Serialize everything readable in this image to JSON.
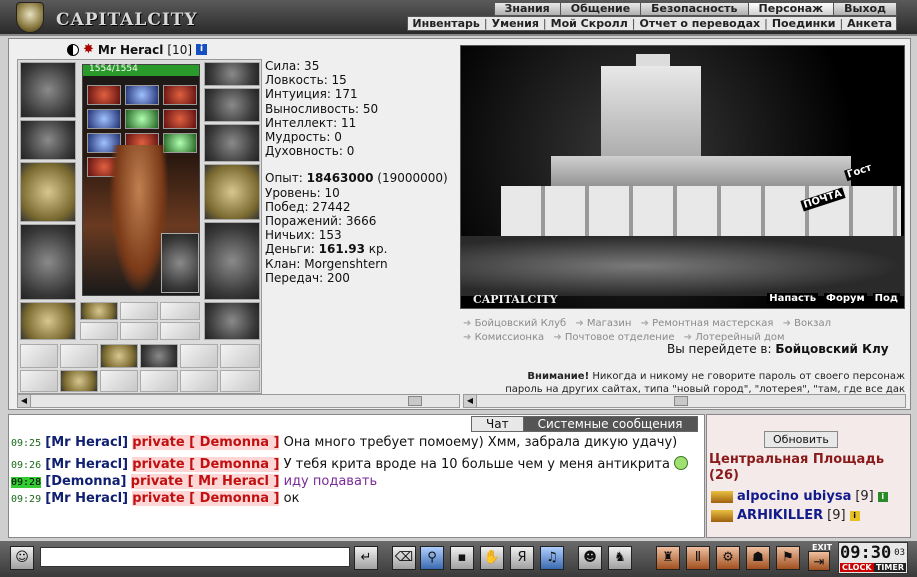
{
  "brand": "CAPITALCITY",
  "nav_top": [
    "Знания",
    "Общение",
    "Безопасность",
    "Персонаж",
    "Выход"
  ],
  "nav_sub": [
    "Инвентарь",
    "Умения",
    "Мой Скролл",
    "Отчет о переводах",
    "Поединки",
    "Анкета"
  ],
  "character": {
    "name": "Mr Heracl",
    "level": "[10]",
    "hp": "1554/1554"
  },
  "stats": {
    "strength": "Сила: 35",
    "agility": "Ловкость: 15",
    "intuition": "Интуиция: 171",
    "endurance": "Выносливость: 50",
    "intellect": "Интеллект: 11",
    "wisdom": "Мудрость: 0",
    "spirit": "Духовность: 0",
    "exp_label": "Опыт:",
    "exp_value": "18463000",
    "exp_next": "(19000000)",
    "level": "Уровень: 10",
    "wins": "Побед: 27442",
    "losses": "Поражений: 3666",
    "draws": "Ничьих: 153",
    "money_label": "Деньги:",
    "money_value": "161.93",
    "money_unit": "кр.",
    "clan": "Клан: Morgenshtern",
    "transfers": "Передач: 200"
  },
  "city": {
    "label": "CAPITALCITY",
    "links": [
      "Напасть",
      "Форум",
      "Под"
    ],
    "signs": [
      "ПОЧТА",
      "Гост"
    ]
  },
  "places": [
    "Бойцовский Клуб",
    "Магазин",
    "Ремонтная мастерская",
    "Вокзал",
    "Комиссионка",
    "Почтовое отделение",
    "Лотерейный дом"
  ],
  "goto": {
    "prefix": "Вы перейдете в:",
    "target": "Бойцовский Клу"
  },
  "warning": {
    "title": "Внимание!",
    "line1": "Никогда и никому не говорите пароль от своего персонаж",
    "line2": "пароль на других сайтах, типа \"новый город\", \"лотерея\", \"там, где все дак"
  },
  "chat_tabs": [
    "Чат",
    "Системные сообщения"
  ],
  "chat": [
    {
      "time": "09:25",
      "nick": "[Mr Heracl]",
      "priv": "private [ Demonna ]",
      "text": "Она много требует помоему) Хмм, забрала дикую удачу)"
    },
    {
      "time": "09:26",
      "nick": "[Mr Heracl]",
      "priv": "private [ Demonna ]",
      "text": "У тебя крита вроде на 10 больше чем у меня антикрита"
    },
    {
      "time": "09:28",
      "nick": "[Demonna]",
      "priv": "private [ Mr Heracl ]",
      "text": "иду подавать"
    },
    {
      "time": "09:29",
      "nick": "[Mr Heracl]",
      "priv": "private [ Demonna ]",
      "text": "ок"
    }
  ],
  "online": {
    "refresh": "Обновить",
    "room": "Центральная Площадь",
    "count": "(26)",
    "users": [
      {
        "name": "alpocino ubiysa",
        "level": "[9]"
      },
      {
        "name": "ARHIKILLER",
        "level": "[9]"
      }
    ]
  },
  "clock": {
    "time": "09:30",
    "seconds": "03",
    "clock_label": "CLOCK",
    "timer_label": "TIMER",
    "exit": "EXIT"
  },
  "colors": {
    "accent": "#8a1a1a",
    "nick": "#102070",
    "private": "#c01010",
    "hp": "#2a9a2a"
  }
}
